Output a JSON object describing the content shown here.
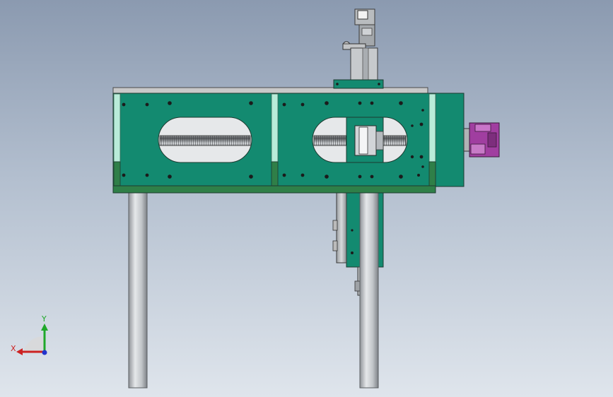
{
  "viewport": {
    "background_top": "#8b9ab0",
    "background_bottom": "#dfe5ec"
  },
  "model": {
    "plate_color": "#138a70",
    "rail_color": "#2f7f48",
    "top_cover_color": "#c9c9c9",
    "shaft_color": "#c4c8cc",
    "motor_color": "#a03ea0",
    "screw_color": "#8a8e92",
    "bolt_color": "#1b1b1b"
  },
  "triad": {
    "x_label": "X",
    "y_label": "Y",
    "x_color": "#cc2222",
    "y_color": "#1fa82a",
    "z_color": "#2233cc"
  }
}
